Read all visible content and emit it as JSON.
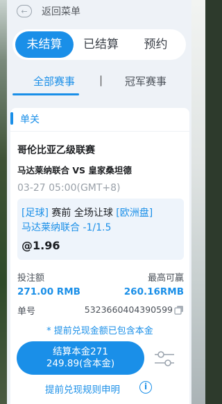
{
  "header": {
    "back_label": "返回菜单"
  },
  "status_tabs": [
    "未结算",
    "已结算",
    "预约"
  ],
  "sub_tabs": {
    "all": "全部赛事",
    "separator": "|",
    "champion": "冠军赛事"
  },
  "bet": {
    "type_label": "单关",
    "league": "哥伦比亚乙级联赛",
    "match": "马达莱纳联合 VS 皇家桑坦德",
    "time": "03-27 05:00(GMT+8)",
    "sport": "[足球]",
    "market": "赛前 全场让球",
    "odds_type": "[欧洲盘]",
    "selection": "马达莱纳联合 -1/1.5",
    "odds": "@1.96",
    "stake_label": "投注额",
    "stake_value": "271.00 RMB",
    "max_win_label": "最高可赢",
    "max_win_value": "260.16RMB",
    "order_label": "单号",
    "order_no": "5323660404390599",
    "note": "* 提前兑现金额已包含本金",
    "cashout_line1": "结算本金271",
    "cashout_line2": "249.89(含本金)",
    "rules_label": "提前兑现规则申明"
  },
  "colors": {
    "accent": "#1a8fe8",
    "panel": "#eef2f7"
  }
}
